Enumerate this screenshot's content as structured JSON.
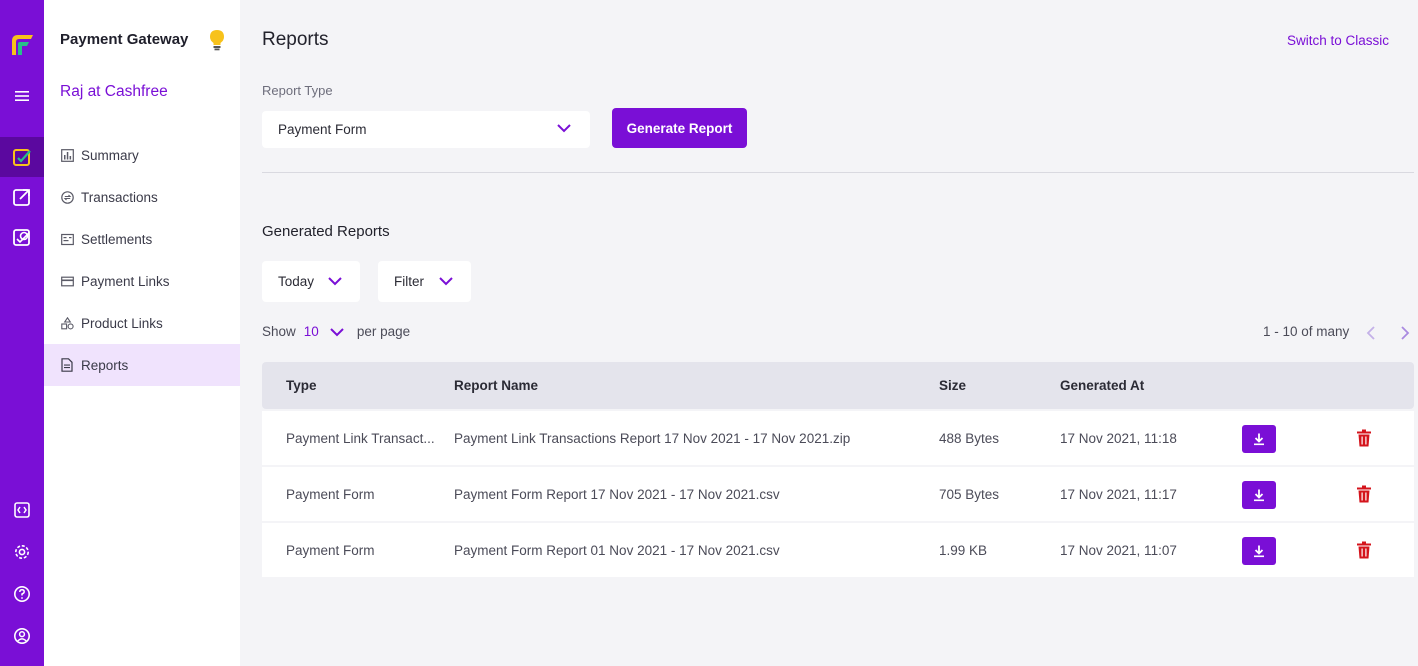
{
  "colors": {
    "brand": "#7a0fd6",
    "brand_dark": "#5b089f",
    "active_bg": "#f0e3fd",
    "delete": "#d4141c"
  },
  "rail": {
    "top_icons": [
      "logo-icon",
      "menu-icon",
      "payment-gateway-icon",
      "payouts-icon",
      "verification-icon"
    ],
    "bottom_icons": [
      "developers-icon",
      "settings-icon",
      "help-icon",
      "profile-icon"
    ]
  },
  "sidebar": {
    "title": "Payment Gateway",
    "account": "Raj at Cashfree",
    "items": [
      {
        "label": "Summary",
        "icon": "bar-chart-icon"
      },
      {
        "label": "Transactions",
        "icon": "transactions-icon"
      },
      {
        "label": "Settlements",
        "icon": "settlements-icon"
      },
      {
        "label": "Payment Links",
        "icon": "card-icon"
      },
      {
        "label": "Product Links",
        "icon": "shapes-icon"
      },
      {
        "label": "Reports",
        "icon": "document-icon",
        "active": true
      }
    ]
  },
  "main": {
    "title": "Reports",
    "switch_link": "Switch to Classic",
    "report_type_label": "Report Type",
    "report_type_value": "Payment Form",
    "generate_button": "Generate Report",
    "generated_title": "Generated Reports",
    "date_filter": "Today",
    "filter_label": "Filter",
    "show_label": "Show",
    "per_page_value": "10",
    "per_page_label": "per page",
    "pagination_text": "1 - 10 of many"
  },
  "table": {
    "headers": {
      "type": "Type",
      "name": "Report Name",
      "size": "Size",
      "generated": "Generated At"
    },
    "rows": [
      {
        "type": "Payment Link Transact...",
        "name": "Payment Link Transactions Report 17 Nov 2021 - 17 Nov 2021.zip",
        "size": "488 Bytes",
        "generated": "17 Nov 2021, 11:18"
      },
      {
        "type": "Payment Form",
        "name": "Payment Form Report 17 Nov 2021 - 17 Nov 2021.csv",
        "size": "705 Bytes",
        "generated": "17 Nov 2021, 11:17"
      },
      {
        "type": "Payment Form",
        "name": "Payment Form Report 01 Nov 2021 - 17 Nov 2021.csv",
        "size": "1.99 KB",
        "generated": "17 Nov 2021, 11:07"
      }
    ]
  }
}
